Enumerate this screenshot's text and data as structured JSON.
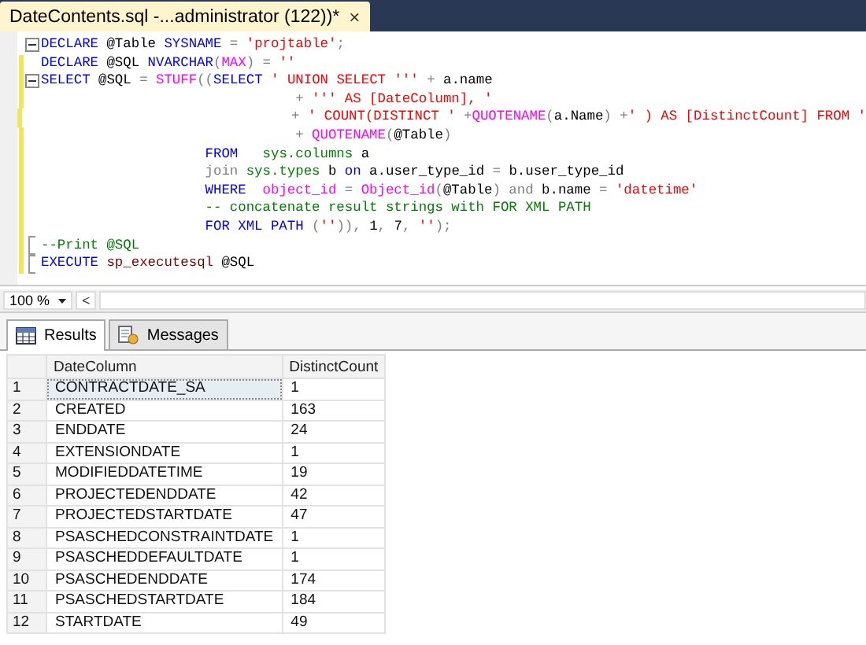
{
  "document_tab": {
    "title": "DateContents.sql -...administrator (122))*",
    "close": "×"
  },
  "editor": {
    "lines": [
      {
        "collapsible": true,
        "block_end": false,
        "changed": false,
        "tokens": [
          {
            "kind": "keyword",
            "text": "DECLARE"
          },
          {
            "kind": "plain",
            "text": " @Table "
          },
          {
            "kind": "keyword",
            "text": "SYSNAME"
          },
          {
            "kind": "operator",
            "text": " = "
          },
          {
            "kind": "string",
            "text": "'projtable'"
          },
          {
            "kind": "operator",
            "text": ";"
          }
        ]
      },
      {
        "collapsible": false,
        "block_end": false,
        "changed": true,
        "tokens": [
          {
            "kind": "keyword",
            "text": "DECLARE"
          },
          {
            "kind": "plain",
            "text": " @SQL "
          },
          {
            "kind": "keyword",
            "text": "NVARCHAR"
          },
          {
            "kind": "operator",
            "text": "("
          },
          {
            "kind": "function",
            "text": "MAX"
          },
          {
            "kind": "operator",
            "text": ") = "
          },
          {
            "kind": "string",
            "text": "''"
          }
        ]
      },
      {
        "collapsible": true,
        "block_end": false,
        "changed": true,
        "tokens": [
          {
            "kind": "keyword",
            "text": "SELECT"
          },
          {
            "kind": "plain",
            "text": " @SQL "
          },
          {
            "kind": "operator",
            "text": "= "
          },
          {
            "kind": "function",
            "text": "STUFF"
          },
          {
            "kind": "operator",
            "text": "(("
          },
          {
            "kind": "keyword",
            "text": "SELECT "
          },
          {
            "kind": "string",
            "text": "' UNION SELECT '''"
          },
          {
            "kind": "operator",
            "text": " + "
          },
          {
            "kind": "plain",
            "text": "a.name"
          }
        ]
      },
      {
        "collapsible": false,
        "block_end": false,
        "changed": true,
        "tokens": [
          {
            "kind": "operator",
            "text": "                               + "
          },
          {
            "kind": "string",
            "text": "''' AS [DateColumn], '"
          }
        ]
      },
      {
        "collapsible": false,
        "block_end": false,
        "changed": true,
        "tokens": [
          {
            "kind": "operator",
            "text": "                               + "
          },
          {
            "kind": "string",
            "text": "' COUNT(DISTINCT '"
          },
          {
            "kind": "operator",
            "text": " +"
          },
          {
            "kind": "function",
            "text": "QUOTENAME"
          },
          {
            "kind": "operator",
            "text": "("
          },
          {
            "kind": "plain",
            "text": "a.Name"
          },
          {
            "kind": "operator",
            "text": ") +"
          },
          {
            "kind": "string",
            "text": "' ) AS [DistinctCount] FROM '"
          }
        ]
      },
      {
        "collapsible": false,
        "block_end": false,
        "changed": true,
        "tokens": [
          {
            "kind": "operator",
            "text": "                               + "
          },
          {
            "kind": "function",
            "text": "QUOTENAME"
          },
          {
            "kind": "operator",
            "text": "("
          },
          {
            "kind": "plain",
            "text": "@Table"
          },
          {
            "kind": "operator",
            "text": ")"
          }
        ]
      },
      {
        "collapsible": false,
        "block_end": false,
        "changed": true,
        "tokens": [
          {
            "kind": "keyword",
            "text": "                    FROM"
          },
          {
            "kind": "system",
            "text": "   sys.columns"
          },
          {
            "kind": "plain",
            "text": " a"
          }
        ]
      },
      {
        "collapsible": false,
        "block_end": false,
        "changed": true,
        "tokens": [
          {
            "kind": "operator",
            "text": "                    join "
          },
          {
            "kind": "system",
            "text": "sys.types"
          },
          {
            "kind": "plain",
            "text": " b "
          },
          {
            "kind": "keyword",
            "text": "on"
          },
          {
            "kind": "plain",
            "text": " a.user_type_id "
          },
          {
            "kind": "operator",
            "text": "="
          },
          {
            "kind": "plain",
            "text": " b.user_type_id"
          }
        ]
      },
      {
        "collapsible": false,
        "block_end": false,
        "changed": true,
        "tokens": [
          {
            "kind": "keyword",
            "text": "                    WHERE  "
          },
          {
            "kind": "function",
            "text": "object_id"
          },
          {
            "kind": "operator",
            "text": " = "
          },
          {
            "kind": "function",
            "text": "Object_id"
          },
          {
            "kind": "operator",
            "text": "("
          },
          {
            "kind": "plain",
            "text": "@Table"
          },
          {
            "kind": "operator",
            "text": ") and "
          },
          {
            "kind": "plain",
            "text": "b.name "
          },
          {
            "kind": "operator",
            "text": "= "
          },
          {
            "kind": "string",
            "text": "'datetime'"
          }
        ]
      },
      {
        "collapsible": false,
        "block_end": false,
        "changed": true,
        "tokens": [
          {
            "kind": "comment",
            "text": "                    -- concatenate result strings with FOR XML PATH"
          }
        ]
      },
      {
        "collapsible": false,
        "block_end": false,
        "changed": true,
        "tokens": [
          {
            "kind": "keyword",
            "text": "                    FOR XML PATH "
          },
          {
            "kind": "operator",
            "text": "("
          },
          {
            "kind": "string",
            "text": "''"
          },
          {
            "kind": "operator",
            "text": ")), "
          },
          {
            "kind": "plain",
            "text": "1"
          },
          {
            "kind": "operator",
            "text": ", "
          },
          {
            "kind": "plain",
            "text": "7"
          },
          {
            "kind": "operator",
            "text": ", "
          },
          {
            "kind": "string",
            "text": "''"
          },
          {
            "kind": "operator",
            "text": ");"
          }
        ]
      },
      {
        "collapsible": false,
        "block_end": true,
        "changed": true,
        "tokens": [
          {
            "kind": "comment",
            "text": "--Print @SQL"
          }
        ]
      },
      {
        "collapsible": false,
        "block_end": true,
        "changed": true,
        "tokens": [
          {
            "kind": "keyword",
            "text": "EXECUTE "
          },
          {
            "kind": "procedure",
            "text": "sp_executesql"
          },
          {
            "kind": "plain",
            "text": " @SQL"
          }
        ]
      }
    ]
  },
  "zoom": {
    "value": "100 %",
    "scroll_left": "<"
  },
  "result_tabs": [
    {
      "label": "Results",
      "selected": true
    },
    {
      "label": "Messages",
      "selected": false
    }
  ],
  "grid": {
    "columns": [
      "DateColumn",
      "DistinctCount"
    ],
    "rows": [
      {
        "number": "1",
        "cells": [
          "CONTRACTDATE_SA",
          "1"
        ],
        "selected": true
      },
      {
        "number": "2",
        "cells": [
          "CREATED",
          "163"
        ],
        "selected": false
      },
      {
        "number": "3",
        "cells": [
          "ENDDATE",
          "24"
        ],
        "selected": false
      },
      {
        "number": "4",
        "cells": [
          "EXTENSIONDATE",
          "1"
        ],
        "selected": false
      },
      {
        "number": "5",
        "cells": [
          "MODIFIEDDATETIME",
          "19"
        ],
        "selected": false
      },
      {
        "number": "6",
        "cells": [
          "PROJECTEDENDDATE",
          "42"
        ],
        "selected": false
      },
      {
        "number": "7",
        "cells": [
          "PROJECTEDSTARTDATE",
          "47"
        ],
        "selected": false
      },
      {
        "number": "8",
        "cells": [
          "PSASCHEDCONSTRAINTDATE",
          "1"
        ],
        "selected": false
      },
      {
        "number": "9",
        "cells": [
          "PSASCHEDDEFAULTDATE",
          "1"
        ],
        "selected": false
      },
      {
        "number": "10",
        "cells": [
          "PSASCHEDENDDATE",
          "174"
        ],
        "selected": false
      },
      {
        "number": "11",
        "cells": [
          "PSASCHEDSTARTDATE",
          "184"
        ],
        "selected": false
      },
      {
        "number": "12",
        "cells": [
          "STARTDATE",
          "49"
        ],
        "selected": false
      }
    ]
  }
}
